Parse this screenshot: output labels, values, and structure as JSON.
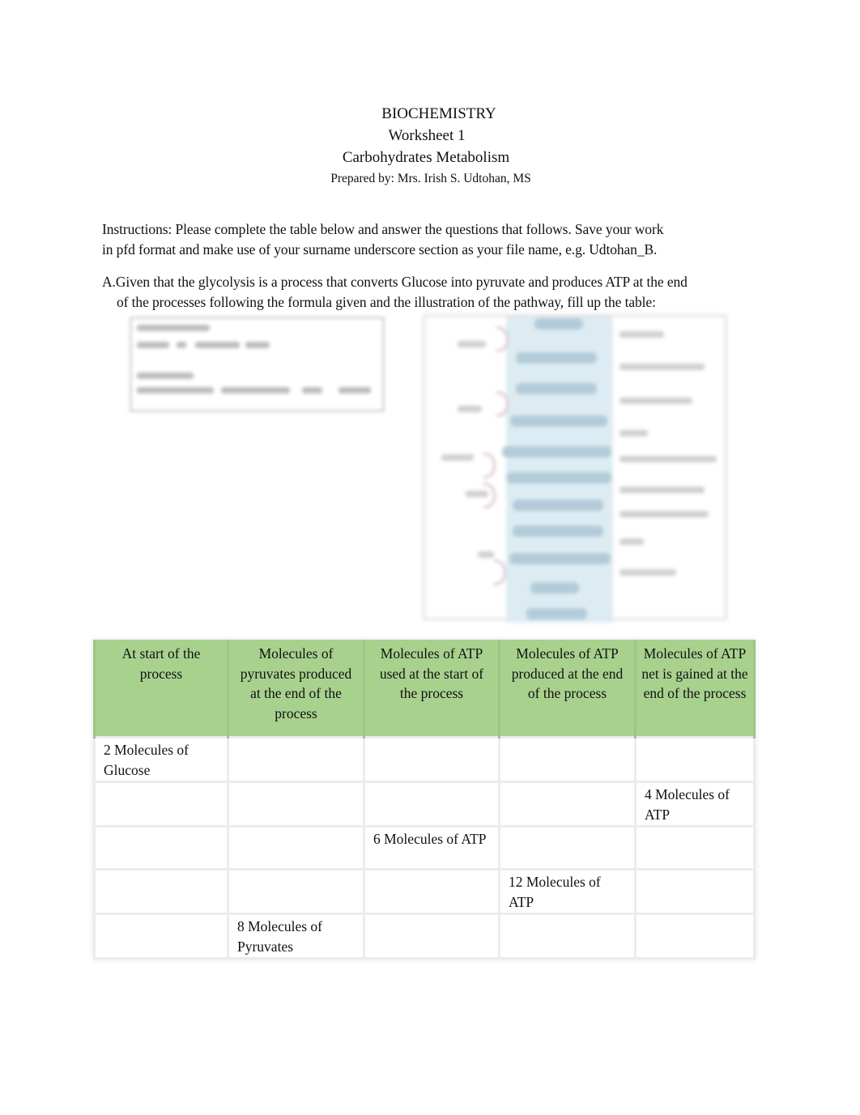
{
  "header": {
    "subject": "BIOCHEMISTRY",
    "worksheet": "Worksheet 1",
    "topic": "Carbohydrates Metabolism",
    "prepared_by": "Prepared by: Mrs. Irish S. Udtohan, MS"
  },
  "instructions": {
    "line1": "Instructions: Please complete the table below and answer the questions that follows. Save your work",
    "line2": "in pfd format and make use of your surname underscore section as your file name, e.g. Udtohan_B."
  },
  "section_a": {
    "line1": "A.Given that the glycolysis is a process that converts Glucose into pyruvate and produces ATP at the end",
    "line2": "of the processes following the formula given and the illustration of the pathway, fill up the table:"
  },
  "images": {
    "formula": "glycolysis-formula-image (blurred)",
    "pathway": "glycolysis-pathway-illustration (blurred)"
  },
  "table": {
    "header_color": "#a9d18e",
    "columns": [
      "At start of the process",
      "Molecules of pyruvates produced at the end of the process",
      "Molecules of ATP used at the start of the process",
      "Molecules of ATP produced at the end of the process",
      "Molecules of ATP net is gained at the end of the process"
    ],
    "rows": [
      [
        "2 Molecules of Glucose",
        "",
        "",
        "",
        ""
      ],
      [
        "",
        "",
        "",
        "",
        "4 Molecules of ATP"
      ],
      [
        "",
        "",
        "6 Molecules of ATP",
        "",
        ""
      ],
      [
        "",
        "",
        "",
        "12 Molecules of ATP",
        ""
      ],
      [
        "",
        "8 Molecules of Pyruvates",
        "",
        "",
        ""
      ]
    ]
  }
}
